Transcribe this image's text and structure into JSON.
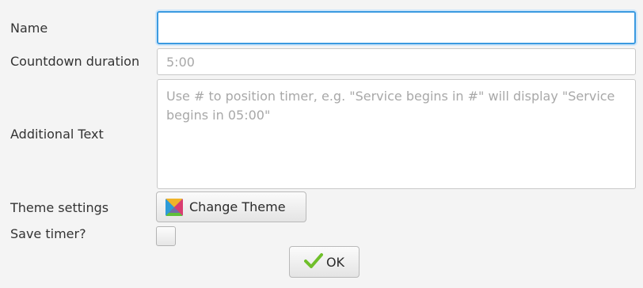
{
  "form": {
    "name": {
      "label": "Name",
      "value": "",
      "placeholder": ""
    },
    "countdown": {
      "label": "Countdown duration",
      "value": "",
      "placeholder": "5:00"
    },
    "additional_text": {
      "label": "Additional Text",
      "value": "",
      "placeholder": "Use # to position timer, e.g. \"Service begins in #\" will display \"Service begins in 05:00\""
    },
    "theme": {
      "label": "Theme settings",
      "button_label": "Change Theme",
      "icon": "palette-icon"
    },
    "save_timer": {
      "label": "Save timer?",
      "checked": false
    },
    "ok": {
      "label": "OK",
      "icon": "check-icon"
    }
  },
  "colors": {
    "focus_border": "#3b9ae0",
    "check_green": "#6fbf2a",
    "background": "#f4f4f4"
  }
}
